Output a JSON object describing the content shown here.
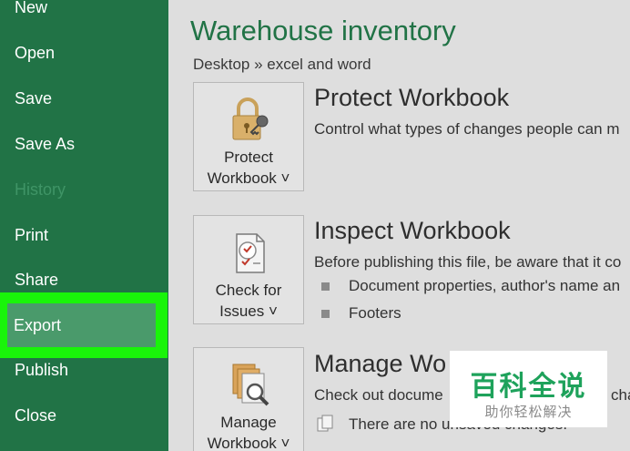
{
  "sidebar": {
    "items": [
      {
        "label": "New"
      },
      {
        "label": "Open"
      },
      {
        "label": "Save"
      },
      {
        "label": "Save As"
      },
      {
        "label": "History"
      },
      {
        "label": "Print"
      },
      {
        "label": "Share"
      },
      {
        "label": "Export"
      },
      {
        "label": "Publish"
      },
      {
        "label": "Close"
      }
    ],
    "selected": "Export",
    "highlight_color": "#19f40a"
  },
  "main": {
    "title": "Warehouse inventory",
    "breadcrumb": "Desktop » excel and word",
    "sections": [
      {
        "tile_line1": "Protect",
        "tile_line2": "Workbook ˅",
        "icon": "padlock-key-icon",
        "title": "Protect Workbook",
        "description": "Control what types of changes people can m"
      },
      {
        "tile_line1": "Check for",
        "tile_line2": "Issues ˅",
        "icon": "document-checklist-icon",
        "title": "Inspect Workbook",
        "description": "Before publishing this file, be aware that it co",
        "bullets": [
          "Document properties, author's name an",
          "Footers"
        ]
      },
      {
        "tile_line1": "Manage",
        "tile_line2": "Workbook ˅",
        "icon": "documents-magnifier-icon",
        "title": "Manage Wo",
        "description": "Check out docume",
        "description_tail": "cha",
        "info": "There are no unsaved changes."
      }
    ]
  },
  "watermark": {
    "main": "百科全说",
    "sub": "助你轻松解决"
  },
  "colors": {
    "sidebar_bg": "#217346",
    "title": "#217346",
    "watermark_green": "#1ea25b"
  }
}
